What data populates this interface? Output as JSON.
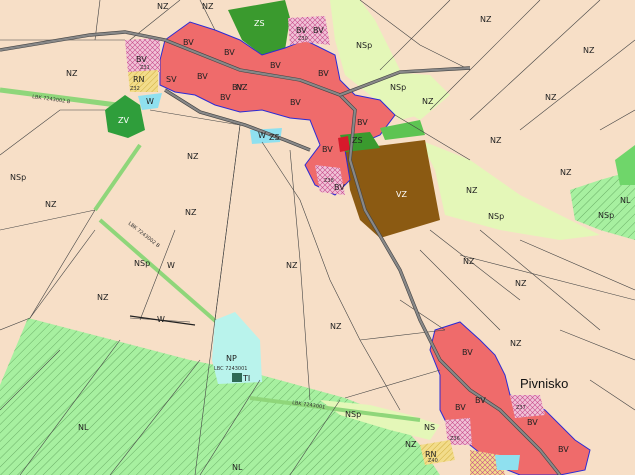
{
  "town_name": "Pivnisko",
  "colors": {
    "background_nz": "#f7dfc7",
    "bv_built_up": "#ef6b6b",
    "zs_green": "#3a9a2e",
    "zv_green": "#2f9e3b",
    "nl_forest": "#a7f0a0",
    "nsp_meadow": "#e4f7b8",
    "vz_production": "#8b5a12",
    "w_water": "#8fe0ef",
    "np_area": "#b9f3ec",
    "rn_hatched": "#f2dc8a",
    "boundary_blue": "#2b2bd6",
    "railway_corridor": "#8fd67a"
  },
  "labels": [
    {
      "id": "nz-top-a",
      "text": "NZ"
    },
    {
      "id": "nz-top-b",
      "text": "NZ"
    },
    {
      "id": "zs-top",
      "text": "ZS"
    },
    {
      "id": "bv-1",
      "text": "BV"
    },
    {
      "id": "bv-2",
      "text": "BV"
    },
    {
      "id": "bv-3",
      "text": "BV"
    },
    {
      "id": "bv-4",
      "text": "BV"
    },
    {
      "id": "bv-5",
      "text": "BV"
    },
    {
      "id": "bv-6",
      "text": "BV"
    },
    {
      "id": "bv-7",
      "text": "BV"
    },
    {
      "id": "bv-8",
      "text": "BV"
    },
    {
      "id": "bv-9",
      "text": "BV"
    },
    {
      "id": "bv-10",
      "text": "BV"
    },
    {
      "id": "bv-11",
      "text": "BV"
    },
    {
      "id": "bv-12",
      "text": "BV"
    },
    {
      "id": "bv-13",
      "text": "BV"
    },
    {
      "id": "bv-14",
      "text": "BV"
    },
    {
      "id": "bv-15",
      "text": "BV"
    },
    {
      "id": "bv-16",
      "text": "BV"
    },
    {
      "id": "bv-17",
      "text": "BV"
    },
    {
      "id": "bv-18",
      "text": "BV"
    },
    {
      "id": "bv-19",
      "text": "BV"
    },
    {
      "id": "sv-1",
      "text": "SV"
    },
    {
      "id": "rn-1",
      "text": "RN"
    },
    {
      "id": "rn-2",
      "text": "RN"
    },
    {
      "id": "w-1",
      "text": "W"
    },
    {
      "id": "w-2",
      "text": "W"
    },
    {
      "id": "w-3",
      "text": "W"
    },
    {
      "id": "w-4",
      "text": "W"
    },
    {
      "id": "zv-1",
      "text": "ZV"
    },
    {
      "id": "zs-2",
      "text": "ZS"
    },
    {
      "id": "zs-3",
      "text": "ZS"
    },
    {
      "id": "nsp-1",
      "text": "NSp"
    },
    {
      "id": "nsp-2",
      "text": "NSp"
    },
    {
      "id": "nsp-3",
      "text": "NSp"
    },
    {
      "id": "nsp-4",
      "text": "NSp"
    },
    {
      "id": "nsp-5",
      "text": "NSp"
    },
    {
      "id": "nsp-6",
      "text": "NSp"
    },
    {
      "id": "nsp-7",
      "text": "NSp"
    },
    {
      "id": "nz-1",
      "text": "NZ"
    },
    {
      "id": "nz-2",
      "text": "NZ"
    },
    {
      "id": "nz-3",
      "text": "NZ"
    },
    {
      "id": "nz-4",
      "text": "NZ"
    },
    {
      "id": "nz-5",
      "text": "NZ"
    },
    {
      "id": "nz-6",
      "text": "NZ"
    },
    {
      "id": "nz-7",
      "text": "NZ"
    },
    {
      "id": "nz-8",
      "text": "NZ"
    },
    {
      "id": "nz-9",
      "text": "NZ"
    },
    {
      "id": "nz-10",
      "text": "NZ"
    },
    {
      "id": "nz-11",
      "text": "NZ"
    },
    {
      "id": "nz-12",
      "text": "NZ"
    },
    {
      "id": "nz-13",
      "text": "NZ"
    },
    {
      "id": "nz-14",
      "text": "NZ"
    },
    {
      "id": "nz-15",
      "text": "NZ"
    },
    {
      "id": "nz-16",
      "text": "NZ"
    },
    {
      "id": "nz-17",
      "text": "NZ"
    },
    {
      "id": "nz-18",
      "text": "NZ"
    },
    {
      "id": "nz-19",
      "text": "NZ"
    },
    {
      "id": "vz-1",
      "text": "VZ"
    },
    {
      "id": "np-1",
      "text": "NP"
    },
    {
      "id": "ti-1",
      "text": "TI"
    },
    {
      "id": "nl-1",
      "text": "NL"
    },
    {
      "id": "nl-2",
      "text": "NL"
    },
    {
      "id": "nl-3",
      "text": "NL"
    },
    {
      "id": "ns-1",
      "text": "NS"
    },
    {
      "id": "z-231",
      "text": "Z31"
    },
    {
      "id": "z-230",
      "text": "Z30"
    },
    {
      "id": "z-232",
      "text": "Z32"
    },
    {
      "id": "z-238",
      "text": "Z38"
    },
    {
      "id": "z-237",
      "text": "Z37"
    },
    {
      "id": "z-236",
      "text": "Z36"
    },
    {
      "id": "z-240",
      "text": "Z40"
    },
    {
      "id": "lbk-1",
      "text": "LBK 7243002 B"
    },
    {
      "id": "lbk-2",
      "text": "LBK 7243002 B"
    },
    {
      "id": "lbc-1",
      "text": "LBC 7243001"
    },
    {
      "id": "lbk-3",
      "text": "LBK 7243001"
    }
  ]
}
